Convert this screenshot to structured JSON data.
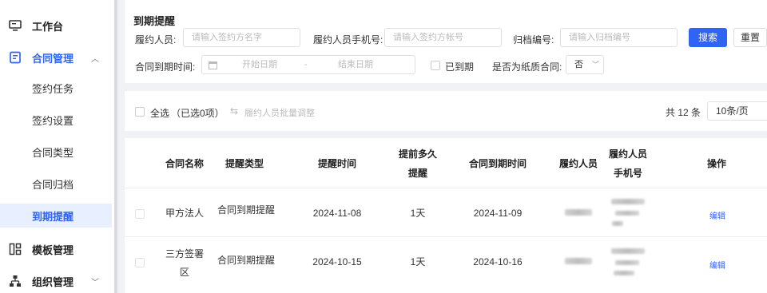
{
  "sidebar": {
    "items": [
      {
        "label": "工作台",
        "icon": "monitor-icon"
      },
      {
        "label": "合同管理",
        "icon": "document-icon",
        "expanded": true
      },
      {
        "label": "模板管理",
        "icon": "template-icon"
      },
      {
        "label": "组织管理",
        "icon": "org-icon"
      }
    ],
    "sub_items": [
      "签约任务",
      "签约设置",
      "合同类型",
      "合同归档",
      "到期提醒"
    ],
    "active_sub": "到期提醒"
  },
  "filter": {
    "title": "到期提醒",
    "performer_label": "履约人员:",
    "performer_placeholder": "请输入签约方名字",
    "phone_label": "履约人员手机号:",
    "phone_placeholder": "请输入签约方帐号",
    "archive_label": "归档编号:",
    "archive_placeholder": "请输入归档编号",
    "search_button": "搜索",
    "reset_button": "重置",
    "expiry_label": "合同到期时间:",
    "start_date": "开始日期",
    "date_sep": "-",
    "end_date": "结束日期",
    "expired_label": "已到期",
    "paper_label": "是否为纸质合同:",
    "paper_value": "否"
  },
  "toolbar": {
    "select_all": "全选",
    "selected_count": "（已选0项）",
    "batch_adjust": "履约人员批量调整",
    "total": "共 12 条",
    "page_size": "10条/页"
  },
  "table": {
    "headers": {
      "name": "合同名称",
      "type": "提醒类型",
      "remind_time": "提醒时间",
      "advance_1": "提前多久",
      "advance_2": "提醒",
      "expiry": "合同到期时间",
      "performer": "履约人员",
      "phone_1": "履约人员",
      "phone_2": "手机号",
      "action": "操作"
    },
    "rows": [
      {
        "name_1": "甲方法人",
        "name_2": "",
        "type": "合同到期提醒",
        "remind_time": "2024-11-08",
        "advance": "1天",
        "expiry": "2024-11-09",
        "action": "编辑"
      },
      {
        "name_1": "三方签署",
        "name_2": "区",
        "type": "合同到期提醒",
        "remind_time": "2024-10-15",
        "advance": "1天",
        "expiry": "2024-10-16",
        "action": "编辑"
      }
    ]
  }
}
